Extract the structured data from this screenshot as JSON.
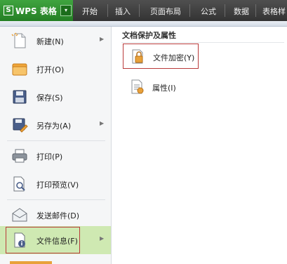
{
  "app": {
    "logo": "S",
    "title": "WPS 表格",
    "dropdown_glyph": "▾"
  },
  "ribbon_tabs": [
    "开始",
    "插入",
    "页面布局",
    "公式",
    "数据",
    "表格样"
  ],
  "menu": {
    "items": [
      {
        "label": "新建(N)",
        "icon": "new-doc-icon",
        "submenu": true
      },
      {
        "label": "打开(O)",
        "icon": "open-folder-icon",
        "submenu": false
      },
      {
        "label": "保存(S)",
        "icon": "save-floppy-icon",
        "submenu": false
      },
      {
        "label": "另存为(A)",
        "icon": "save-as-icon",
        "submenu": true
      },
      {
        "label": "打印(P)",
        "icon": "printer-icon",
        "submenu": false
      },
      {
        "label": "打印预览(V)",
        "icon": "print-preview-icon",
        "submenu": false
      },
      {
        "label": "发送邮件(D)",
        "icon": "envelope-icon",
        "submenu": false
      },
      {
        "label": "文件信息(F)",
        "icon": "file-info-icon",
        "submenu": true,
        "selected": true
      }
    ],
    "submenu_arrow": "▶"
  },
  "panel": {
    "title": "文档保护及属性",
    "items": [
      {
        "label": "文件加密(Y)",
        "icon": "lock-document-icon",
        "highlighted": true
      },
      {
        "label": "属性(I)",
        "icon": "properties-icon",
        "highlighted": false
      }
    ]
  },
  "colors": {
    "app_green": "#2f8f2f",
    "ribbon_dark": "#3c3c3c",
    "selected_bg": "#cfe9b2",
    "highlight_border": "#b93a3a"
  }
}
